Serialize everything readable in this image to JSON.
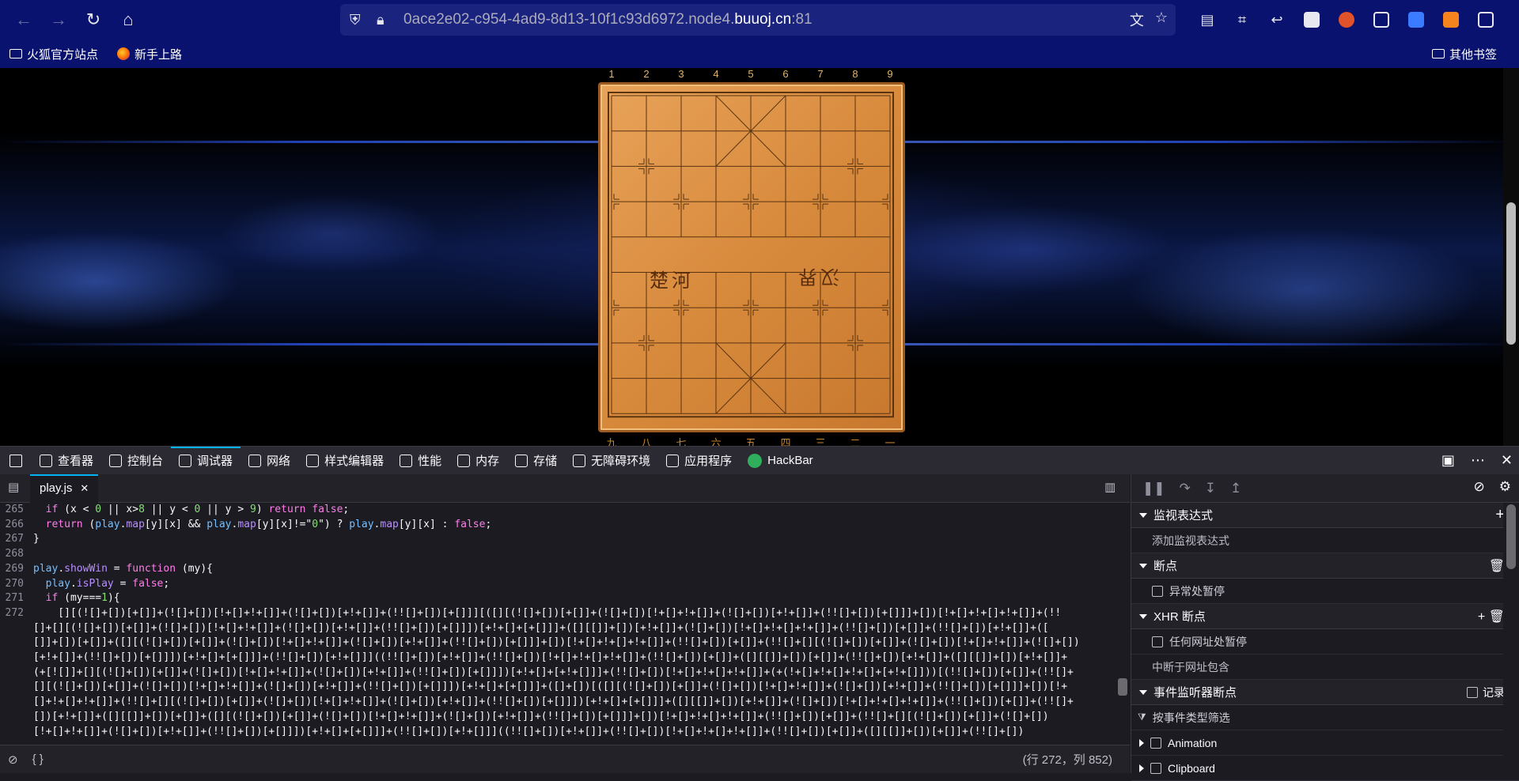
{
  "browser": {
    "url_prefix": "0ace2e02-c954-4ad9-8d13-10f1c93d6972.node4.",
    "url_domain": "buuoj.cn",
    "url_suffix": ":81"
  },
  "bookmarks": {
    "left": [
      {
        "label": "火狐官方站点",
        "icon": "folder-icon"
      },
      {
        "label": "新手上路",
        "icon": "firefox-icon"
      }
    ],
    "right": {
      "label": "其他书签",
      "icon": "folder-icon"
    }
  },
  "game": {
    "col_numbers": [
      "1",
      "2",
      "3",
      "4",
      "5",
      "6",
      "7",
      "8",
      "9"
    ],
    "col_bottom": [
      "九",
      "八",
      "七",
      "六",
      "五",
      "四",
      "三",
      "二",
      "一"
    ],
    "river_left": "楚河",
    "river_right": "汉界"
  },
  "devtools": {
    "tabs": [
      {
        "label": "查看器",
        "icon": "inspector-icon"
      },
      {
        "label": "控制台",
        "icon": "console-icon"
      },
      {
        "label": "调试器",
        "icon": "debugger-icon",
        "active": true
      },
      {
        "label": "网络",
        "icon": "network-icon"
      },
      {
        "label": "样式编辑器",
        "icon": "style-editor-icon"
      },
      {
        "label": "性能",
        "icon": "performance-icon"
      },
      {
        "label": "内存",
        "icon": "memory-icon"
      },
      {
        "label": "存储",
        "icon": "storage-icon"
      },
      {
        "label": "无障碍环境",
        "icon": "accessibility-icon"
      },
      {
        "label": "应用程序",
        "icon": "application-icon"
      },
      {
        "label": "HackBar",
        "icon": "hackbar-icon"
      }
    ],
    "source_file": "play.js",
    "code_lines": [
      {
        "n": "265",
        "text": "  if (x < 0 || x>8 || y < 0 || y > 9) return false;"
      },
      {
        "n": "266",
        "text": "  return (play.map[y][x] && play.map[y][x]!=\"0\") ? play.map[y][x] : false;"
      },
      {
        "n": "267",
        "text": "}"
      },
      {
        "n": "268",
        "text": ""
      },
      {
        "n": "269",
        "text": "play.showWin = function (my){"
      },
      {
        "n": "270",
        "text": "  play.isPlay = false;"
      },
      {
        "n": "271",
        "text": "  if (my===1){"
      },
      {
        "n": "272",
        "text": "    [][(![]+[])[+[]]+(![]+[])[!+[]+!+[]]+(![]+[])[+!+[]]+(!![]+[])[+[]]][([][(![]+[])[+[]]+(![]+[])[!+[]+!+[]]+(![]+[])[+!+[]]+(!![]+[])[+[]]]+[])[!+[]+!+[]+!+[]]+(!!"
      }
    ],
    "wrapped_lines": [
      "[]+[][(![]+[])[+[]]+(![]+[])[!+[]+!+[]]+(![]+[])[+!+[]]+(!![]+[])[+[]]])[+!+[]+[+[]]]+([][[]]+[])[+!+[]]+(![]+[])[!+[]+!+[]+!+[]]+(!![]+[])[+[]]+(!![]+[])[+!+[]]+([",
      "[]]+[])[+[]]+([][(![]+[])[+[]]+(![]+[])[!+[]+!+[]]+(![]+[])[+!+[]]+(!![]+[])[+[]]]+[])[!+[]+!+[]+!+[]]+(!![]+[])[+[]]+(!![]+[][(![]+[])[+[]]+(![]+[])[!+[]+!+[]]+(![]+[])",
      "[+!+[]]+(!![]+[])[+[]]])[+!+[]+[+[]]]+(!![]+[])[+!+[]]]((!![]+[])[+!+[]]+(!![]+[])[!+[]+!+[]+!+[]]+(!![]+[])[+[]]+([][[]]+[])[+[]]+(!![]+[])[+!+[]]+([][[]]+[])[+!+[]]+",
      "(+[![]]+[][(![]+[])[+[]]+(![]+[])[!+[]+!+[]]+(![]+[])[+!+[]]+(!![]+[])[+[]]])[+!+[]+[+!+[]]]+(!![]+[])[!+[]+!+[]+!+[]]+(+(!+[]+!+[]+!+[]+[+!+[]]))[(!![]+[])[+[]]+(!![]+",
      "[][(![]+[])[+[]]+(![]+[])[!+[]+!+[]]+(![]+[])[+!+[]]+(!![]+[])[+[]]])[+!+[]+[+[]]]+([]+[])[([][(![]+[])[+[]]+(![]+[])[!+[]+!+[]]+(![]+[])[+!+[]]+(!![]+[])[+[]]]+[])[!+",
      "[]+!+[]+!+[]]+(!![]+[][(![]+[])[+[]]+(![]+[])[!+[]+!+[]]+(![]+[])[+!+[]]+(!![]+[])[+[]]])[+!+[]+[+[]]]+([][[]]+[])[+!+[]]+(![]+[])[!+[]+!+[]+!+[]]+(!![]+[])[+[]]+(!![]+",
      "[])[+!+[]]+([][[]]+[])[+[]]+([][(![]+[])[+[]]+(![]+[])[!+[]+!+[]]+(![]+[])[+!+[]]+(!![]+[])[+[]]]+[])[!+[]+!+[]+!+[]]+(!![]+[])[+[]]+(!![]+[][(![]+[])[+[]]+(![]+[])",
      "[!+[]+!+[]]+(![]+[])[+!+[]]+(!![]+[])[+[]]])[+!+[]+[+[]]]+(!![]+[])[+!+[]]]((!![]+[])[+!+[]]+(!![]+[])[!+[]+!+[]+!+[]]+(!![]+[])[+[]]+([][[]]+[])[+[]]+(!![]+[])"
    ],
    "footer_brace": "{ }",
    "cursor_position": "(行 272，列 852)",
    "right_panel": {
      "sections": [
        {
          "title": "监视表达式",
          "expanded": true,
          "action": "add-icon",
          "rows": [
            {
              "label": "添加监视表达式",
              "checkbox": false
            }
          ]
        },
        {
          "title": "断点",
          "expanded": true,
          "action": "trash-icon",
          "rows": [
            {
              "label": "异常处暂停",
              "checkbox": true
            }
          ]
        },
        {
          "title": "XHR 断点",
          "expanded": true,
          "action": "add-trash",
          "rows": [
            {
              "label": "任何网址处暂停",
              "checkbox": true
            },
            {
              "label": "中断于网址包含",
              "checkbox": false
            }
          ]
        },
        {
          "title": "事件监听器断点",
          "expanded": true,
          "action": "record",
          "record_label": "记录",
          "rows": [
            {
              "label": "按事件类型筛选",
              "checkbox": false,
              "filter": true
            },
            {
              "label": "Animation",
              "checkbox": true,
              "collapsed": true
            },
            {
              "label": "Clipboard",
              "checkbox": true,
              "collapsed": true
            }
          ]
        }
      ]
    }
  }
}
